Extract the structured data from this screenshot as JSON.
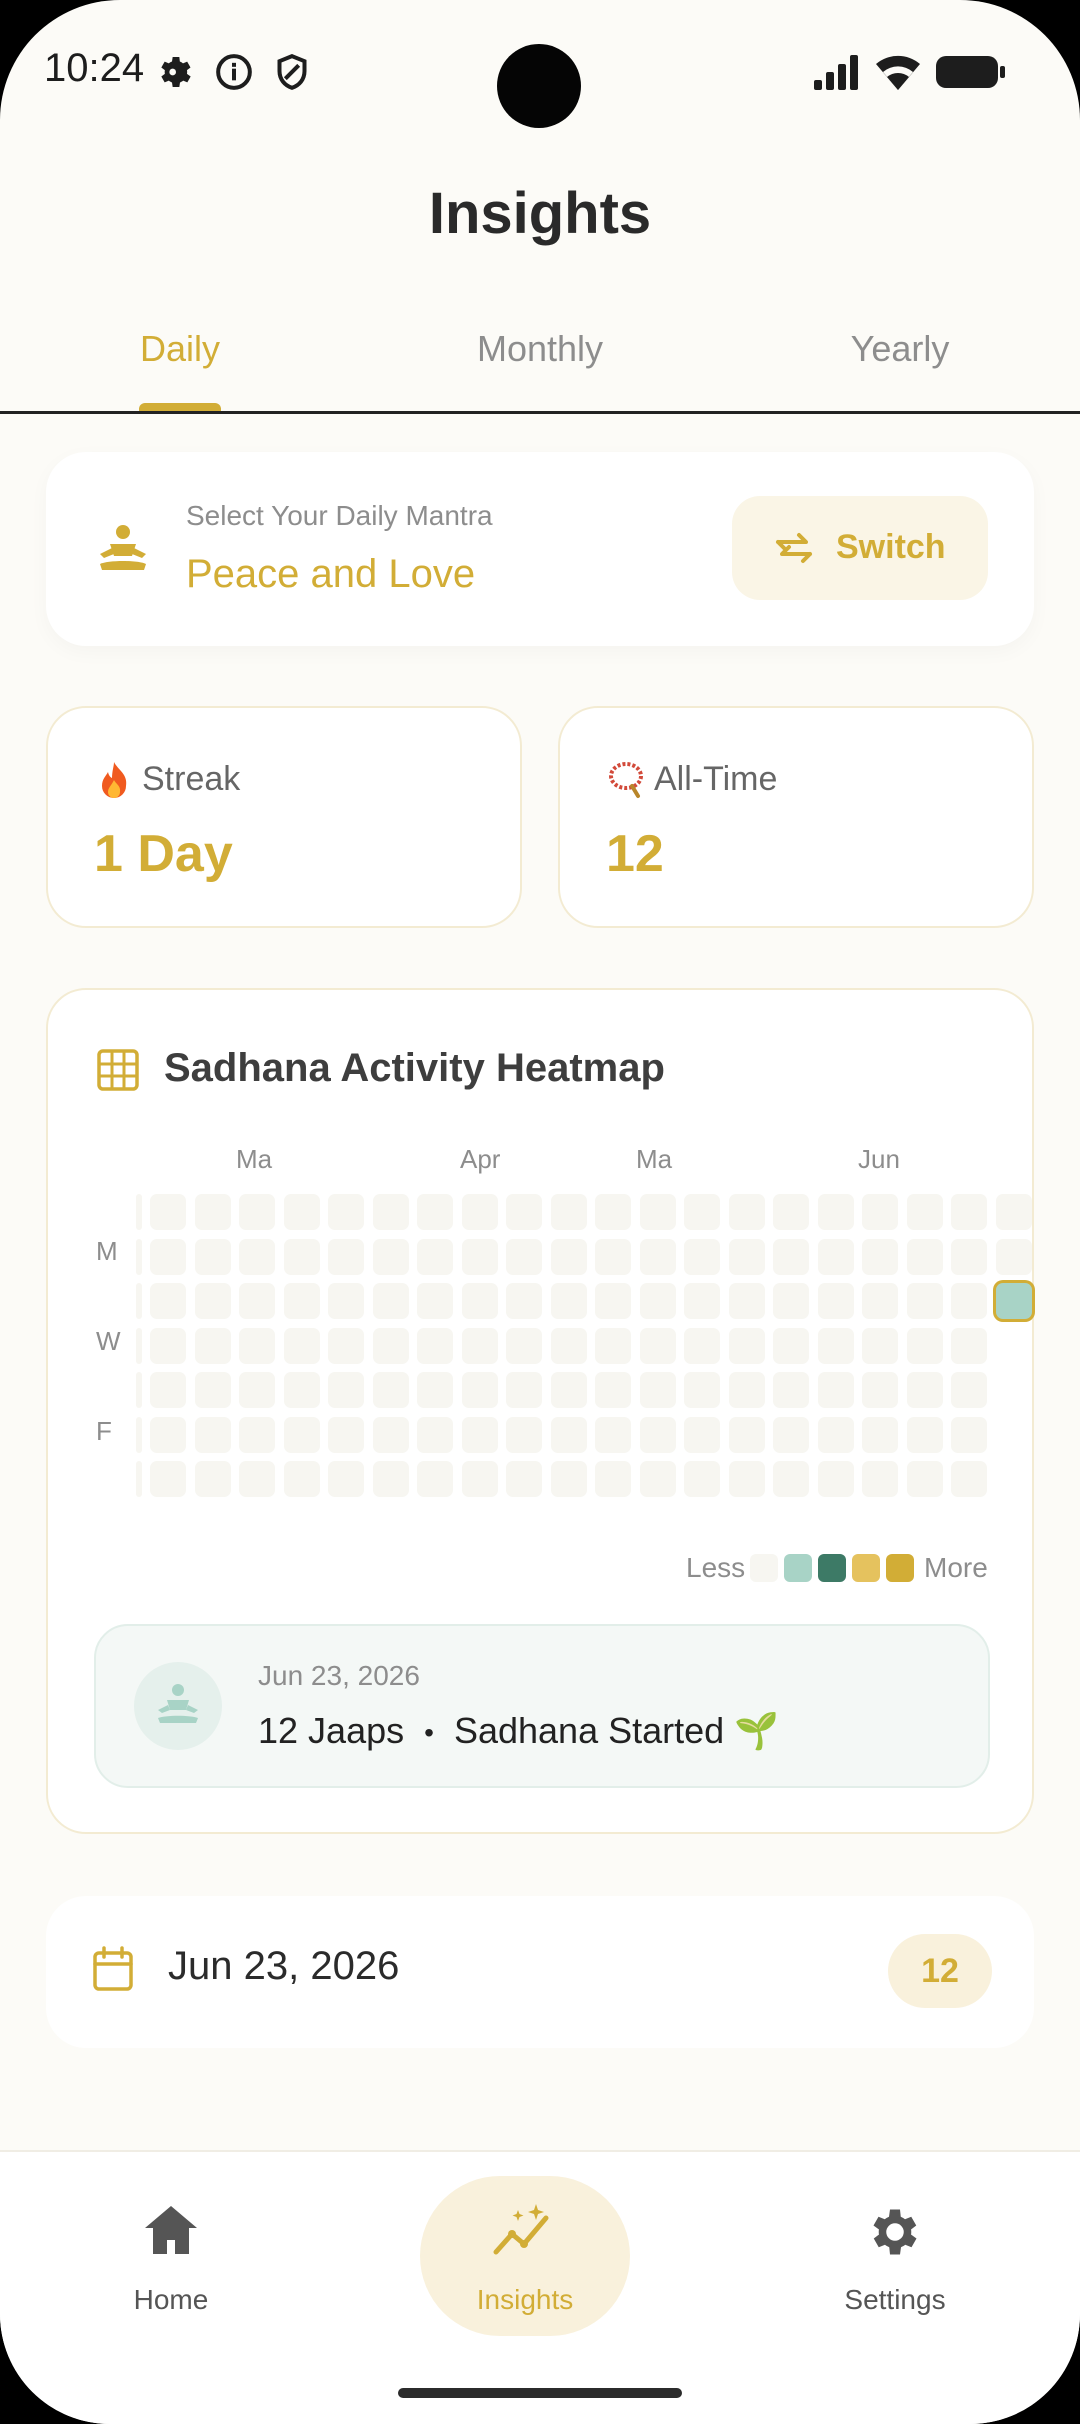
{
  "status_bar": {
    "time": "10:24"
  },
  "page": {
    "title": "Insights"
  },
  "tabs": [
    {
      "label": "Daily",
      "active": true
    },
    {
      "label": "Monthly",
      "active": false
    },
    {
      "label": "Yearly",
      "active": false
    }
  ],
  "mantra": {
    "subtitle": "Select Your Daily Mantra",
    "name": "Peace and Love",
    "switch_label": "Switch",
    "icon": "meditation-icon"
  },
  "stats": [
    {
      "label": "Streak",
      "value": "1 Day",
      "icon": "fire-icon"
    },
    {
      "label": "All-Time",
      "value": "12",
      "icon": "mala-beads-icon"
    }
  ],
  "heatmap": {
    "title": "Sadhana Activity Heatmap",
    "icon": "grid-icon",
    "months": [
      "Ma",
      "Apr",
      "Ma",
      "Jun"
    ],
    "days": [
      "M",
      "W",
      "F"
    ],
    "legend_less": "Less",
    "legend_more": "More",
    "colors": [
      "#f7f6f1",
      "#a8d3c6",
      "#3d7a66",
      "#e5c25e",
      "#d2ad36"
    ],
    "active_cell": {
      "week": 19,
      "day": 2,
      "level": 1
    },
    "selected": {
      "date": "Jun 23, 2026",
      "summary": "12 Jaaps",
      "separator": "•",
      "status": "Sadhana Started 🌱"
    }
  },
  "date_entry": {
    "date": "Jun 23, 2026",
    "count": "12",
    "icon": "calendar-icon"
  },
  "nav": [
    {
      "label": "Home",
      "icon": "home-icon",
      "active": false
    },
    {
      "label": "Insights",
      "icon": "insights-icon",
      "active": true
    },
    {
      "label": "Settings",
      "icon": "gear-icon",
      "active": false
    }
  ],
  "colors": {
    "accent": "#d2ad36",
    "accent_soft": "#f9f1dc",
    "background": "#fcfbf7"
  }
}
